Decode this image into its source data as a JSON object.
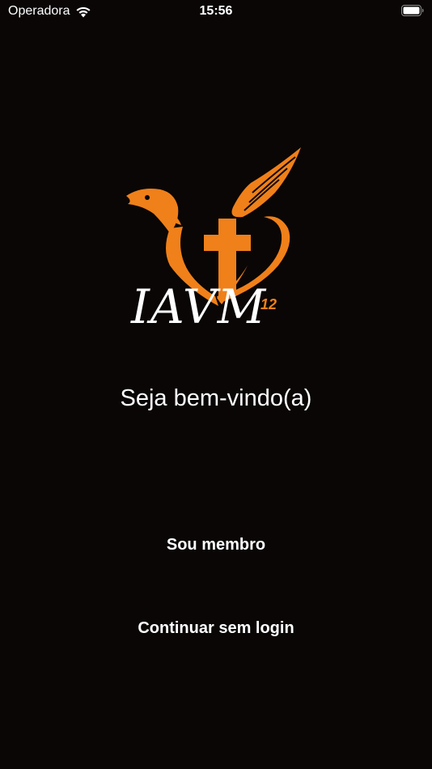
{
  "status_bar": {
    "carrier": "Operadora",
    "time": "15:56",
    "wifi_icon": "wifi-icon",
    "battery_icon": "battery-icon"
  },
  "logo": {
    "wordmark": "IAVM",
    "superscript": "12",
    "icon": "eagle-cross-heart-logo",
    "accent_color": "#f08019"
  },
  "welcome_text": "Seja bem-vindo(a)",
  "buttons": {
    "member_label": "Sou membro",
    "guest_label": "Continuar sem login"
  },
  "colors": {
    "background": "#0a0606",
    "text": "#ffffff",
    "accent": "#f08019"
  }
}
